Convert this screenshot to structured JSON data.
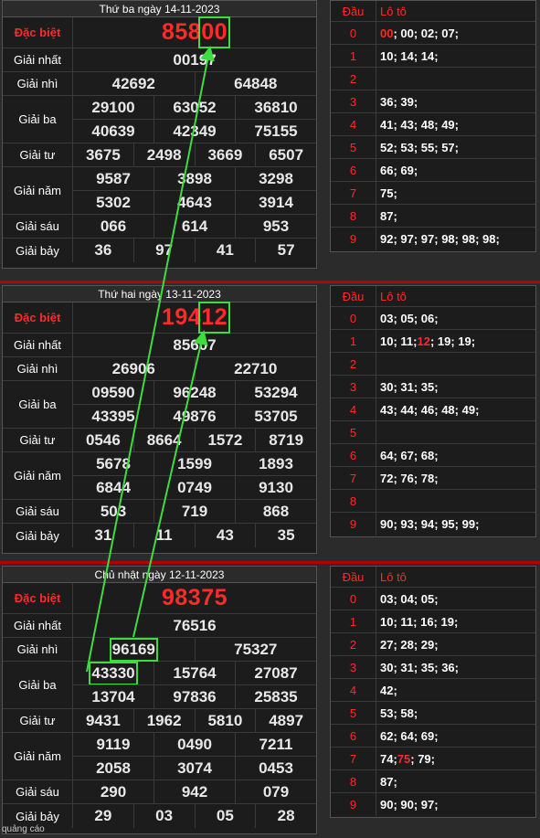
{
  "panels": [
    {
      "title": "Thứ ba ngày 14-11-2023",
      "labels": [
        "Đặc biệt",
        "Giải nhất",
        "Giải nhì",
        "Giải ba",
        "Giải tư",
        "Giải năm",
        "Giải sáu",
        "Giải bảy"
      ],
      "special_a": "858",
      "special_b": "00",
      "g1": "00197",
      "g2": [
        "42692",
        "64848"
      ],
      "g3a": [
        "29100",
        "63052",
        "36810"
      ],
      "g3b": [
        "40639",
        "42349",
        "75155"
      ],
      "g4": [
        "3675",
        "2498",
        "3669",
        "6507"
      ],
      "g5a": [
        "9587",
        "3898",
        "3298"
      ],
      "g5b": [
        "5302",
        "4643",
        "3914"
      ],
      "g6": [
        "066",
        "614",
        "953"
      ],
      "g7": [
        "36",
        "97",
        "41",
        "57"
      ],
      "loto_header": {
        "dau": "Đầu",
        "loto": "Lô tô"
      },
      "loto": [
        {
          "d": "0",
          "hl": "00",
          "rest": "; 00; 02; 07;"
        },
        {
          "d": "1",
          "v": "10; 14; 14;"
        },
        {
          "d": "2",
          "v": ""
        },
        {
          "d": "3",
          "v": "36; 39;"
        },
        {
          "d": "4",
          "v": "41; 43; 48; 49;"
        },
        {
          "d": "5",
          "v": "52; 53; 55; 57;"
        },
        {
          "d": "6",
          "v": "66; 69;"
        },
        {
          "d": "7",
          "v": "75;"
        },
        {
          "d": "8",
          "v": "87;"
        },
        {
          "d": "9",
          "v": "92; 97; 97; 98; 98; 98;"
        }
      ]
    },
    {
      "title": "Thứ hai ngày 13-11-2023",
      "labels": [
        "Đặc biệt",
        "Giải nhất",
        "Giải nhì",
        "Giải ba",
        "Giải tư",
        "Giải năm",
        "Giải sáu",
        "Giải bảy"
      ],
      "special_a": "194",
      "special_b": "12",
      "g1": "85607",
      "g2": [
        "26906",
        "22710"
      ],
      "g3a": [
        "09590",
        "96248",
        "53294"
      ],
      "g3b": [
        "43395",
        "49876",
        "53705"
      ],
      "g4": [
        "0546",
        "8664",
        "1572",
        "8719"
      ],
      "g5a": [
        "5678",
        "1599",
        "1893"
      ],
      "g5b": [
        "6844",
        "0749",
        "9130"
      ],
      "g6": [
        "503",
        "719",
        "868"
      ],
      "g7": [
        "31",
        "11",
        "43",
        "35"
      ],
      "loto_header": {
        "dau": "Đầu",
        "loto": "Lô tô"
      },
      "loto": [
        {
          "d": "0",
          "v": "03; 05; 06;"
        },
        {
          "d": "1",
          "pre": "10; 11; ",
          "hl": "12",
          "rest": "; 19; 19;"
        },
        {
          "d": "2",
          "v": ""
        },
        {
          "d": "3",
          "v": "30; 31; 35;"
        },
        {
          "d": "4",
          "v": "43; 44; 46; 48; 49;"
        },
        {
          "d": "5",
          "v": ""
        },
        {
          "d": "6",
          "v": "64; 67; 68;"
        },
        {
          "d": "7",
          "v": "72; 76; 78;"
        },
        {
          "d": "8",
          "v": ""
        },
        {
          "d": "9",
          "v": "90; 93; 94; 95; 99;"
        }
      ]
    },
    {
      "title": "Chủ nhật ngày 12-11-2023",
      "labels": [
        "Đặc biệt",
        "Giải nhất",
        "Giải nhì",
        "Giải ba",
        "Giải tư",
        "Giải năm",
        "Giải sáu",
        "Giải bảy"
      ],
      "special": "98375",
      "g1": "76516",
      "g2": [
        "96169",
        "75327"
      ],
      "g3a": [
        "43330",
        "15764",
        "27087"
      ],
      "g3b": [
        "13704",
        "97836",
        "25835"
      ],
      "g4": [
        "9431",
        "1962",
        "5810",
        "4897"
      ],
      "g5a": [
        "9119",
        "0490",
        "7211"
      ],
      "g5b": [
        "2058",
        "3074",
        "0453"
      ],
      "g6": [
        "290",
        "942",
        "079"
      ],
      "g7": [
        "29",
        "03",
        "05",
        "28"
      ],
      "loto_header": {
        "dau": "Đầu",
        "loto": "Lô tô"
      },
      "loto": [
        {
          "d": "0",
          "v": "03; 04; 05;"
        },
        {
          "d": "1",
          "v": "10; 11; 16; 19;"
        },
        {
          "d": "2",
          "v": "27; 28; 29;"
        },
        {
          "d": "3",
          "v": "30; 31; 35; 36;"
        },
        {
          "d": "4",
          "v": "42;"
        },
        {
          "d": "5",
          "v": "53; 58;"
        },
        {
          "d": "6",
          "v": "62; 64; 69;"
        },
        {
          "d": "7",
          "pre": "74; ",
          "hl": "75",
          "rest": "; 79;"
        },
        {
          "d": "8",
          "v": "87;"
        },
        {
          "d": "9",
          "v": "90; 90; 97;"
        }
      ]
    }
  ],
  "ad_text": "quảng cáo",
  "colors": {
    "accent_red": "#ff2a2a",
    "highlight_green": "#3fdc3f"
  }
}
